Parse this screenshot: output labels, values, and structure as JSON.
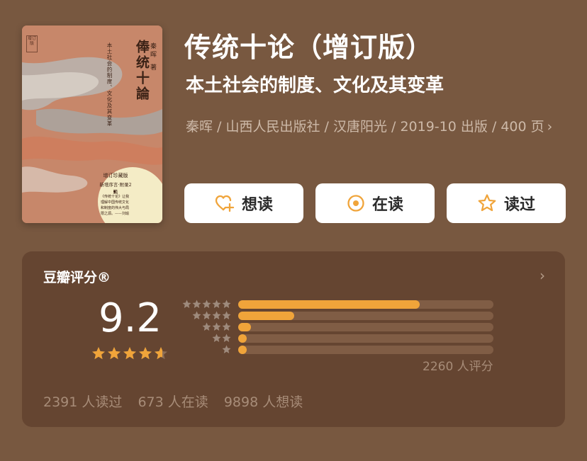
{
  "cover": {
    "title": "俸统十論",
    "subtitle": "本土社会的制度、文化及其变革",
    "author": "秦晖 著",
    "edition_tag": "增订版",
    "seal_line1": "增订珍藏版",
    "seal_line2": "新增序言·附录2篇",
    "seal_quote": "《传统十论》让我理解中国传统文化和制度的伟大与局限之源。——刘瑜"
  },
  "book": {
    "title": "传统十论（增订版）",
    "subtitle": "本土社会的制度、文化及其变革",
    "meta": "秦晖 / 山西人民出版社 / 汉唐阳光 / 2019-10 出版 / 400 页",
    "meta_chevron": "›"
  },
  "actions": {
    "want": "想读",
    "reading": "在读",
    "read": "读过"
  },
  "rating": {
    "label": "豆瓣评分®",
    "arrow": "›",
    "score": "9.2",
    "stars_value": 4.6,
    "distribution": [
      0.71,
      0.22,
      0.05,
      0.03,
      0.03
    ],
    "count": "2260 人评分",
    "stats": [
      "2391 人读过",
      "673 人在读",
      "9898 人想读"
    ]
  },
  "colors": {
    "background": "#785840",
    "card": "#654531",
    "accent": "#f0a43a"
  },
  "icons": {
    "want": "heart-plus-icon",
    "reading": "target-icon",
    "read": "star-icon"
  }
}
